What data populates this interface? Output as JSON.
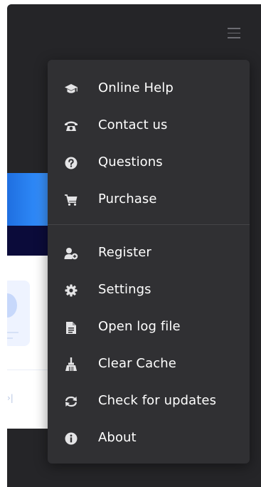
{
  "window": {
    "background": "#252528"
  },
  "header": {
    "menu_icon": "hamburger-icon"
  },
  "menu": {
    "background": "#303033",
    "text_color": "#ffffff",
    "icon_color": "#e4e4e6",
    "groups": [
      {
        "items": [
          {
            "label": "Online Help",
            "icon": "graduation-cap-icon"
          },
          {
            "label": "Contact us",
            "icon": "telephone-icon"
          },
          {
            "label": "Questions",
            "icon": "question-circle-icon"
          },
          {
            "label": "Purchase",
            "icon": "shopping-cart-icon"
          }
        ]
      },
      {
        "items": [
          {
            "label": "Register",
            "icon": "add-user-icon"
          },
          {
            "label": "Settings",
            "icon": "gear-icon"
          },
          {
            "label": "Open log file",
            "icon": "document-icon"
          },
          {
            "label": "Clear Cache",
            "icon": "broom-icon"
          },
          {
            "label": "Check for updates",
            "icon": "refresh-icon"
          },
          {
            "label": "About",
            "icon": "info-circle-icon"
          }
        ]
      }
    ]
  },
  "background_app": {
    "banner_color": "#2c86f5",
    "navy_band_color": "#0b0b3a",
    "card_color": "#ffffff"
  }
}
